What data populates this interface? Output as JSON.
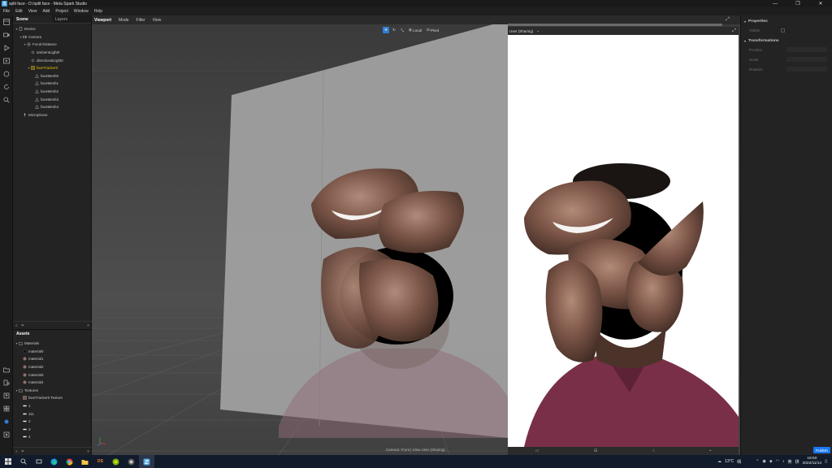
{
  "window": {
    "title": "split face - D:/split face - Meta Spark Studio",
    "logo_letter": "S"
  },
  "menu": [
    "File",
    "Edit",
    "View",
    "Add",
    "Project",
    "Window",
    "Help"
  ],
  "scene_panel": {
    "tabs": [
      "Scene",
      "Layers"
    ],
    "tree": [
      {
        "label": "Device",
        "indent": 0,
        "caret": "▾",
        "icon": "device-icon"
      },
      {
        "label": "Camera",
        "indent": 1,
        "caret": "▾",
        "icon": "camera-icon"
      },
      {
        "label": "Focal Distance",
        "indent": 2,
        "caret": "▾",
        "icon": "focal-distance-icon"
      },
      {
        "label": "ambientLight0",
        "indent": 3,
        "caret": "",
        "icon": "light-icon"
      },
      {
        "label": "directionalLight0",
        "indent": 3,
        "caret": "",
        "icon": "light-icon"
      },
      {
        "label": "faceTracker0",
        "indent": 3,
        "caret": "▾",
        "icon": "face-tracker-icon",
        "selected": true
      },
      {
        "label": "faceMesh0",
        "indent": 4,
        "caret": "",
        "icon": "mesh-icon"
      },
      {
        "label": "faceMesh1",
        "indent": 4,
        "caret": "",
        "icon": "mesh-icon"
      },
      {
        "label": "faceMesh2",
        "indent": 4,
        "caret": "",
        "icon": "mesh-icon"
      },
      {
        "label": "faceMesh3",
        "indent": 4,
        "caret": "",
        "icon": "mesh-icon"
      },
      {
        "label": "faceMesh4",
        "indent": 4,
        "caret": "",
        "icon": "mesh-icon"
      },
      {
        "label": "Microphone",
        "indent": 1,
        "caret": "",
        "icon": "microphone-icon"
      }
    ]
  },
  "assets_panel": {
    "title": "Assets",
    "tree": [
      {
        "label": "Materials",
        "indent": 0,
        "caret": "▾",
        "icon": "folder-icon"
      },
      {
        "label": "material0",
        "indent": 1,
        "caret": "",
        "icon": "material-dark-icon"
      },
      {
        "label": "material1",
        "indent": 1,
        "caret": "",
        "icon": "material-icon"
      },
      {
        "label": "material2",
        "indent": 1,
        "caret": "",
        "icon": "material-icon"
      },
      {
        "label": "material3",
        "indent": 1,
        "caret": "",
        "icon": "material-icon"
      },
      {
        "label": "material4",
        "indent": 1,
        "caret": "",
        "icon": "material-icon"
      },
      {
        "label": "Textures",
        "indent": 0,
        "caret": "▾",
        "icon": "folder-icon"
      },
      {
        "label": "faceTracker0 Texture",
        "indent": 1,
        "caret": "",
        "icon": "texture-icon"
      },
      {
        "label": "1",
        "indent": 1,
        "caret": "",
        "icon": "texture-white-icon"
      },
      {
        "label": "111",
        "indent": 1,
        "caret": "",
        "icon": "texture-white-icon"
      },
      {
        "label": "2",
        "indent": 1,
        "caret": "",
        "icon": "texture-white-icon"
      },
      {
        "label": "3",
        "indent": 1,
        "caret": "",
        "icon": "texture-white-icon"
      },
      {
        "label": "4",
        "indent": 1,
        "caret": "",
        "icon": "texture-white-icon"
      }
    ]
  },
  "viewport": {
    "tabs": [
      "Viewport",
      "Mode",
      "Filter",
      "View"
    ],
    "toolbar": {
      "local_label": "Local",
      "pivot_label": "Pivot"
    },
    "caption": "Camera: Front | View User (Sharing)"
  },
  "preview": {
    "title": "User (Sharing)"
  },
  "properties_panel": {
    "title": "Properties",
    "visible_label": "Visible",
    "transformations_title": "Transformations",
    "position_label": "Position",
    "scale_label": "Scale",
    "rotation_label": "Rotation",
    "publish_label": "Publish"
  },
  "taskbar": {
    "weather": "13°C",
    "weather_suffix": "晴",
    "ime": "英",
    "ime2": "拼",
    "time": "18:50",
    "date": "2022/11/14"
  },
  "colors": {
    "accent": "#1877f2",
    "selected": "#e6c200",
    "viewport_bg": "#505050",
    "taskbar": "#111b2b"
  }
}
